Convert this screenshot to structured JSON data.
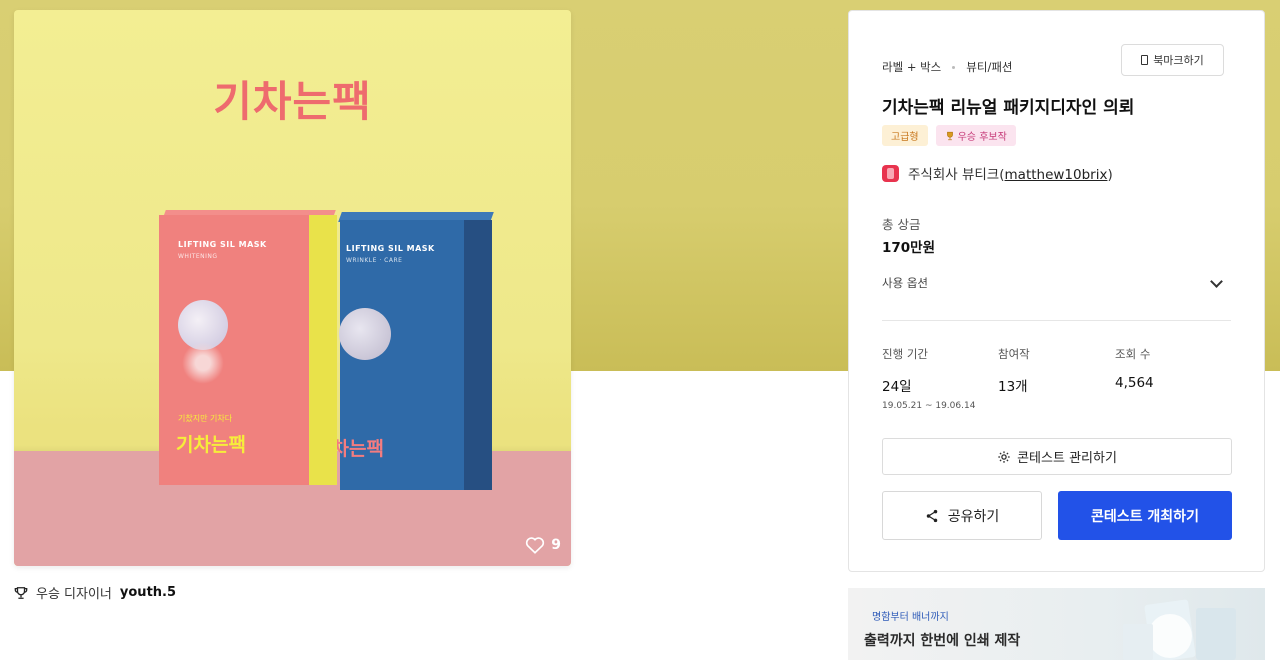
{
  "image": {
    "brand_title": "기차는팩",
    "box_label_pink": "LIFTING SIL MASK",
    "box_sub_pink": "WHITENING",
    "box_label_blue": "LIFTING SIL MASK",
    "box_sub_blue": "WRINKLE · CARE",
    "box_small_text": "기찼지만 기차다",
    "box_korean": "기차는팩",
    "likes": "9"
  },
  "designer": {
    "prefix": "우승 디자이너",
    "name": "youth.5"
  },
  "contest": {
    "category_main": "라벨 + 박스",
    "category_sub": "뷰티/패션",
    "bookmark_label": "북마크하기",
    "title": "기차는팩 리뉴얼 패키지디자인 의뢰",
    "badge_premium": "고급형",
    "badge_winner": "우승 후보작",
    "client_name": "주식회사 뷰티크",
    "client_id": "matthew10brix",
    "prize_label": "총 상금",
    "prize_value": "170만원",
    "options_label": "사용 옵션",
    "period_label": "진행 기간",
    "period_value": "24일",
    "period_dates": "19.05.21 ~ 19.06.14",
    "entries_label": "참여작",
    "entries_value": "13개",
    "views_label": "조회 수",
    "views_value": "4,564",
    "manage_label": "콘테스트 관리하기",
    "share_label": "공유하기",
    "host_label": "콘테스트 개최하기"
  },
  "banner": {
    "tag": "명함부터 배너까지",
    "title": "출력까지 한번에 인쇄 제작"
  },
  "colors": {
    "hero_bg": "#d9cf73",
    "primary_button": "#2252e8",
    "premium_badge": "#c8771d",
    "winner_badge": "#c63a78"
  }
}
